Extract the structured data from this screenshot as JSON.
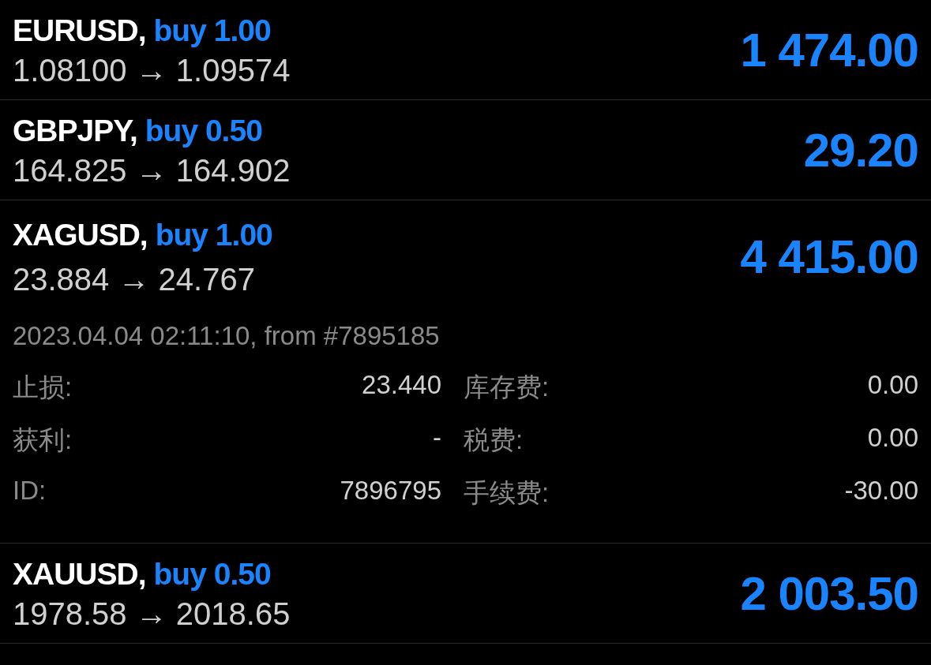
{
  "positions": [
    {
      "symbol": "EURUSD,",
      "order": "buy 1.00",
      "prices": "1.08100 → 1.09574",
      "profit": "1 474.00",
      "expanded": false
    },
    {
      "symbol": "GBPJPY,",
      "order": "buy 0.50",
      "prices": "164.825 → 164.902",
      "profit": "29.20",
      "expanded": false
    },
    {
      "symbol": "XAGUSD,",
      "order": "buy 1.00",
      "prices": "23.884 → 24.767",
      "profit": "4 415.00",
      "expanded": true,
      "details": {
        "opened": "2023.04.04 02:11:10, from #7895185",
        "fields": [
          {
            "label": "止损:",
            "value": "23.440",
            "label_2": "库存费:",
            "value_2": "0.00"
          },
          {
            "label": "获利:",
            "value": "-",
            "label_2": "税费:",
            "value_2": "0.00"
          },
          {
            "label": "ID:",
            "value": "7896795",
            "label_2": "手续费:",
            "value_2": "-30.00"
          }
        ]
      }
    },
    {
      "symbol": "XAUUSD,",
      "order": "buy 0.50",
      "prices": "1978.58 → 2018.65",
      "profit": "2 003.50",
      "expanded": false
    }
  ]
}
